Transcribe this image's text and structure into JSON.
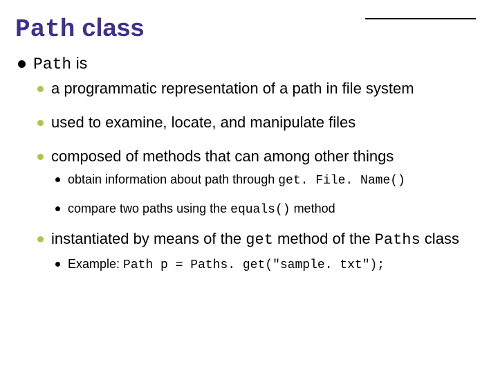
{
  "title": {
    "code": "Path",
    "rest": " class"
  },
  "l1": {
    "code": "Path",
    "rest": " is"
  },
  "l2": {
    "a": "a programmatic representation of a path in file system",
    "b": "used to examine, locate, and manipulate files",
    "c": "composed of methods that can among other things",
    "d_pre": "instantiated by means of the ",
    "d_code1": "get",
    "d_mid": " method of the ",
    "d_code2": "Paths",
    "d_post": " class"
  },
  "l3": {
    "a_pre": "obtain information about path through ",
    "a_code": "get. File. Name()",
    "b_pre": "compare two paths using the ",
    "b_code": "equals()",
    "b_post": " method",
    "c_pre": "Example: ",
    "c_code": "Path p = Paths. get(\"sample. txt\");"
  }
}
